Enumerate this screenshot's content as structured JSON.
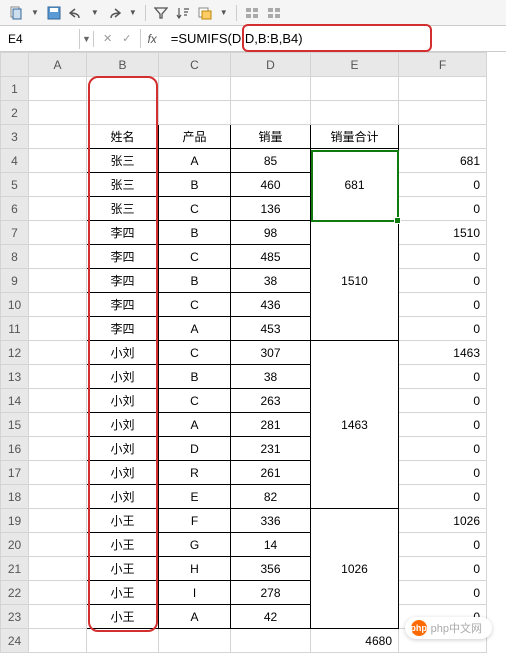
{
  "toolbar": {
    "paste_icon": "paste-icon",
    "save_icon": "save-icon",
    "undo_icon": "undo-icon",
    "redo_icon": "redo-icon",
    "filter_icon": "filter-icon",
    "sort_icon": "sort-icon",
    "format_icon": "format-icon",
    "options1_icon": "options-icon",
    "options2_icon": "options-icon"
  },
  "formula_bar": {
    "name_box": "E4",
    "cancel": "✕",
    "confirm": "✓",
    "fx": "fx",
    "formula": "=SUMIFS(D:D,B:B,B4)"
  },
  "columns": [
    "A",
    "B",
    "C",
    "D",
    "E",
    "F"
  ],
  "headers": {
    "name": "姓名",
    "product": "产品",
    "sales": "销量",
    "total": "销量合计"
  },
  "rows": [
    {
      "r": 1,
      "blank": true
    },
    {
      "r": 2,
      "blank": true
    },
    {
      "r": 3,
      "header": true
    },
    {
      "r": 4,
      "name": "张三",
      "product": "A",
      "sales": 85,
      "total": 681,
      "f": 681,
      "mergestart": true,
      "mergerows": 3
    },
    {
      "r": 5,
      "name": "张三",
      "product": "B",
      "sales": 460,
      "f": 0
    },
    {
      "r": 6,
      "name": "张三",
      "product": "C",
      "sales": 136,
      "f": 0
    },
    {
      "r": 7,
      "name": "李四",
      "product": "B",
      "sales": 98,
      "total": 1510,
      "f": 1510,
      "mergestart": true,
      "mergerows": 5
    },
    {
      "r": 8,
      "name": "李四",
      "product": "C",
      "sales": 485,
      "f": 0
    },
    {
      "r": 9,
      "name": "李四",
      "product": "B",
      "sales": 38,
      "f": 0
    },
    {
      "r": 10,
      "name": "李四",
      "product": "C",
      "sales": 436,
      "f": 0
    },
    {
      "r": 11,
      "name": "李四",
      "product": "A",
      "sales": 453,
      "f": 0
    },
    {
      "r": 12,
      "name": "小刘",
      "product": "C",
      "sales": 307,
      "total": 1463,
      "f": 1463,
      "mergestart": true,
      "mergerows": 7
    },
    {
      "r": 13,
      "name": "小刘",
      "product": "B",
      "sales": 38,
      "f": 0
    },
    {
      "r": 14,
      "name": "小刘",
      "product": "C",
      "sales": 263,
      "f": 0
    },
    {
      "r": 15,
      "name": "小刘",
      "product": "A",
      "sales": 281,
      "f": 0
    },
    {
      "r": 16,
      "name": "小刘",
      "product": "D",
      "sales": 231,
      "f": 0
    },
    {
      "r": 17,
      "name": "小刘",
      "product": "R",
      "sales": 261,
      "f": 0
    },
    {
      "r": 18,
      "name": "小刘",
      "product": "E",
      "sales": 82,
      "f": 0
    },
    {
      "r": 19,
      "name": "小王",
      "product": "F",
      "sales": 336,
      "total": 1026,
      "f": 1026,
      "mergestart": true,
      "mergerows": 5
    },
    {
      "r": 20,
      "name": "小王",
      "product": "G",
      "sales": 14,
      "f": 0
    },
    {
      "r": 21,
      "name": "小王",
      "product": "H",
      "sales": 356,
      "f": 0
    },
    {
      "r": 22,
      "name": "小王",
      "product": "I",
      "sales": 278,
      "f": 0
    },
    {
      "r": 23,
      "name": "小王",
      "product": "A",
      "sales": 42,
      "f": 0
    },
    {
      "r": 24,
      "blank": true,
      "e": 4680
    }
  ],
  "watermark": {
    "logo": "php",
    "text": "php中文网"
  }
}
